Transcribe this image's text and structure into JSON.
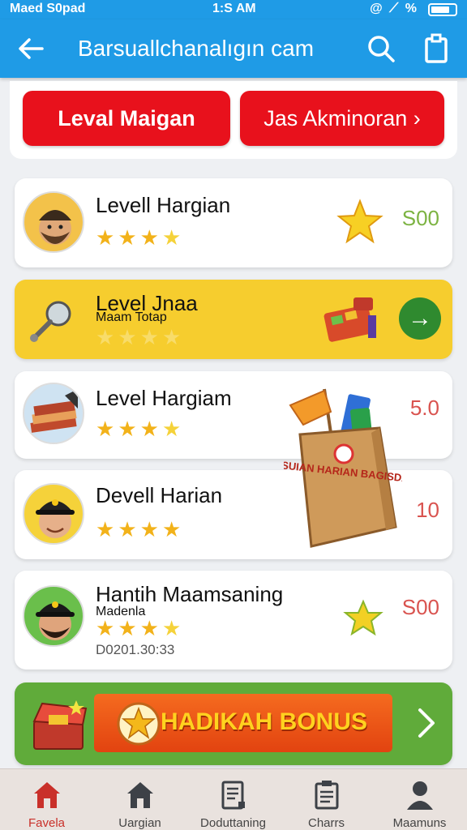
{
  "status_bar": {
    "carrier": "Maed S0pad",
    "time": "1:S AM",
    "indicators": "@ ⟋ % "
  },
  "app_bar": {
    "title": "Barsuallchanalıgın cam"
  },
  "tabs": [
    {
      "label": "Leval Maigan",
      "active": true
    },
    {
      "label": "Jas Akminoran ›",
      "active": false
    }
  ],
  "entries": [
    {
      "name": "Levell Hargian",
      "subtitle": "",
      "date": "",
      "rating": 4,
      "amount": "S00",
      "amount_color": "#7cb342"
    },
    {
      "name": "Level Jnaa",
      "subtitle": "Maam Totap",
      "date": "",
      "rating": 4,
      "amount": "",
      "action": "→"
    },
    {
      "name": "Level Hargiam",
      "subtitle": "",
      "date": "",
      "rating": 4,
      "amount": "5.0",
      "amount_color": "#d9534f"
    },
    {
      "name": "Devell Harian",
      "subtitle": "",
      "date": "",
      "rating": 4,
      "amount": "10",
      "amount_color": "#d9534f"
    },
    {
      "name": "Hantih Maamsaning",
      "subtitle": "Madenla",
      "date": "D0201.30:33",
      "rating": 4,
      "amount": "S00",
      "amount_color": "#d9534f"
    }
  ],
  "bag_text": "DASUIAN HARIAN BAGISDAR",
  "bonus": {
    "label": "HADIKAH BONUS"
  },
  "bottom_nav": [
    {
      "label": "Favela",
      "icon": "home-icon",
      "active": true
    },
    {
      "label": "Uargian",
      "icon": "house-icon",
      "active": false
    },
    {
      "label": "Doduttaning",
      "icon": "document-icon",
      "active": false
    },
    {
      "label": "Charrs",
      "icon": "clipboard-icon",
      "active": false
    },
    {
      "label": "Maamuns",
      "icon": "person-icon",
      "active": false
    }
  ],
  "colors": {
    "primary": "#1f9be6",
    "tab_red": "#e8111c",
    "highlight": "#f6cd2e",
    "bonus_green": "#60ab3a"
  }
}
